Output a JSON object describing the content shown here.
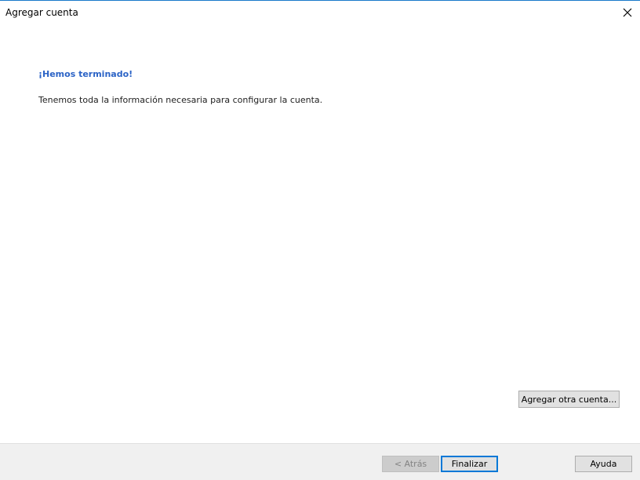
{
  "window": {
    "title": "Agregar cuenta",
    "close_icon": "close-icon"
  },
  "content": {
    "heading": "¡Hemos terminado!",
    "message": "Tenemos toda la información necesaria para configurar la cuenta."
  },
  "buttons": {
    "add_another_account": "Agregar otra cuenta...",
    "back": "< Atrás",
    "finish": "Finalizar",
    "help": "Ayuda"
  },
  "colors": {
    "heading": "#2b63c6",
    "focus_border": "#0078d7",
    "footer_background": "#f0f0f0"
  }
}
